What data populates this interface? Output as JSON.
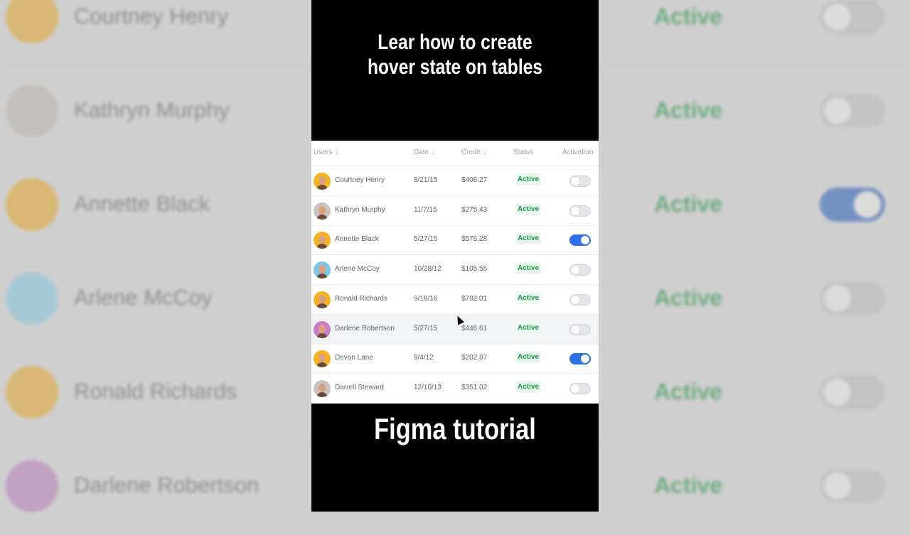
{
  "headline": {
    "line1": "Lear how to create",
    "line2": "hover state on tables"
  },
  "footer": {
    "title": "Figma tutorial"
  },
  "table": {
    "columns": [
      {
        "label": "Users",
        "sort_icon": "arrow-down-icon"
      },
      {
        "label": "Date",
        "sort_icon": "arrow-down-icon"
      },
      {
        "label": "Credit",
        "sort_icon": "arrow-down-icon"
      },
      {
        "label": "Status"
      },
      {
        "label": "Activation"
      }
    ],
    "sort_glyph": "↓",
    "hover_row_index": 5,
    "rows": [
      {
        "name": "Courtney Henry",
        "date": "8/21/15",
        "credit": "$406.27",
        "status": "Active",
        "activation": false,
        "avatar_color": "#f5b223"
      },
      {
        "name": "Kathryn Murphy",
        "date": "11/7/16",
        "credit": "$275.43",
        "status": "Active",
        "activation": false,
        "avatar_color": "#c9c2bd"
      },
      {
        "name": "Annette Black",
        "date": "5/27/15",
        "credit": "$576.28",
        "status": "Active",
        "activation": true,
        "avatar_color": "#f5b223"
      },
      {
        "name": "Arlene McCoy",
        "date": "10/28/12",
        "credit": "$105.55",
        "status": "Active",
        "activation": false,
        "avatar_color": "#7cc7e8"
      },
      {
        "name": "Ronald Richards",
        "date": "9/18/16",
        "credit": "$782.01",
        "status": "Active",
        "activation": false,
        "avatar_color": "#f5b223"
      },
      {
        "name": "Darlene Robertson",
        "date": "5/27/15",
        "credit": "$446.61",
        "status": "Active",
        "activation": false,
        "avatar_color": "#c77ec7"
      },
      {
        "name": "Devon Lane",
        "date": "9/4/12",
        "credit": "$202.87",
        "status": "Active",
        "activation": true,
        "avatar_color": "#f5b223"
      },
      {
        "name": "Darrell Steward",
        "date": "12/10/13",
        "credit": "$351.02",
        "status": "Active",
        "activation": false,
        "avatar_color": "#c9c2bd"
      }
    ]
  },
  "colors": {
    "status_green": "#1e9e45",
    "toggle_on": "#2f6fe4",
    "hover_row": "#f2f3f5"
  },
  "background": {
    "rows": [
      {
        "name": "Courtney Henry",
        "status": "Active",
        "activation": false,
        "avatar_color": "#e0a52a"
      },
      {
        "name": "Kathryn Murphy",
        "status": "Active",
        "activation": false,
        "avatar_color": "#b9b2ad"
      },
      {
        "name": "Annette Black",
        "status": "Active",
        "activation": true,
        "avatar_color": "#e0a52a"
      },
      {
        "name": "Arlene McCoy",
        "status": "Active",
        "activation": false,
        "avatar_color": "#86c4dc"
      },
      {
        "name": "Ronald Richards",
        "status": "Active",
        "activation": false,
        "avatar_color": "#e0a52a"
      },
      {
        "name": "Darlene Robertson",
        "status": "Active",
        "activation": false,
        "avatar_color": "#b87cb8"
      }
    ]
  }
}
